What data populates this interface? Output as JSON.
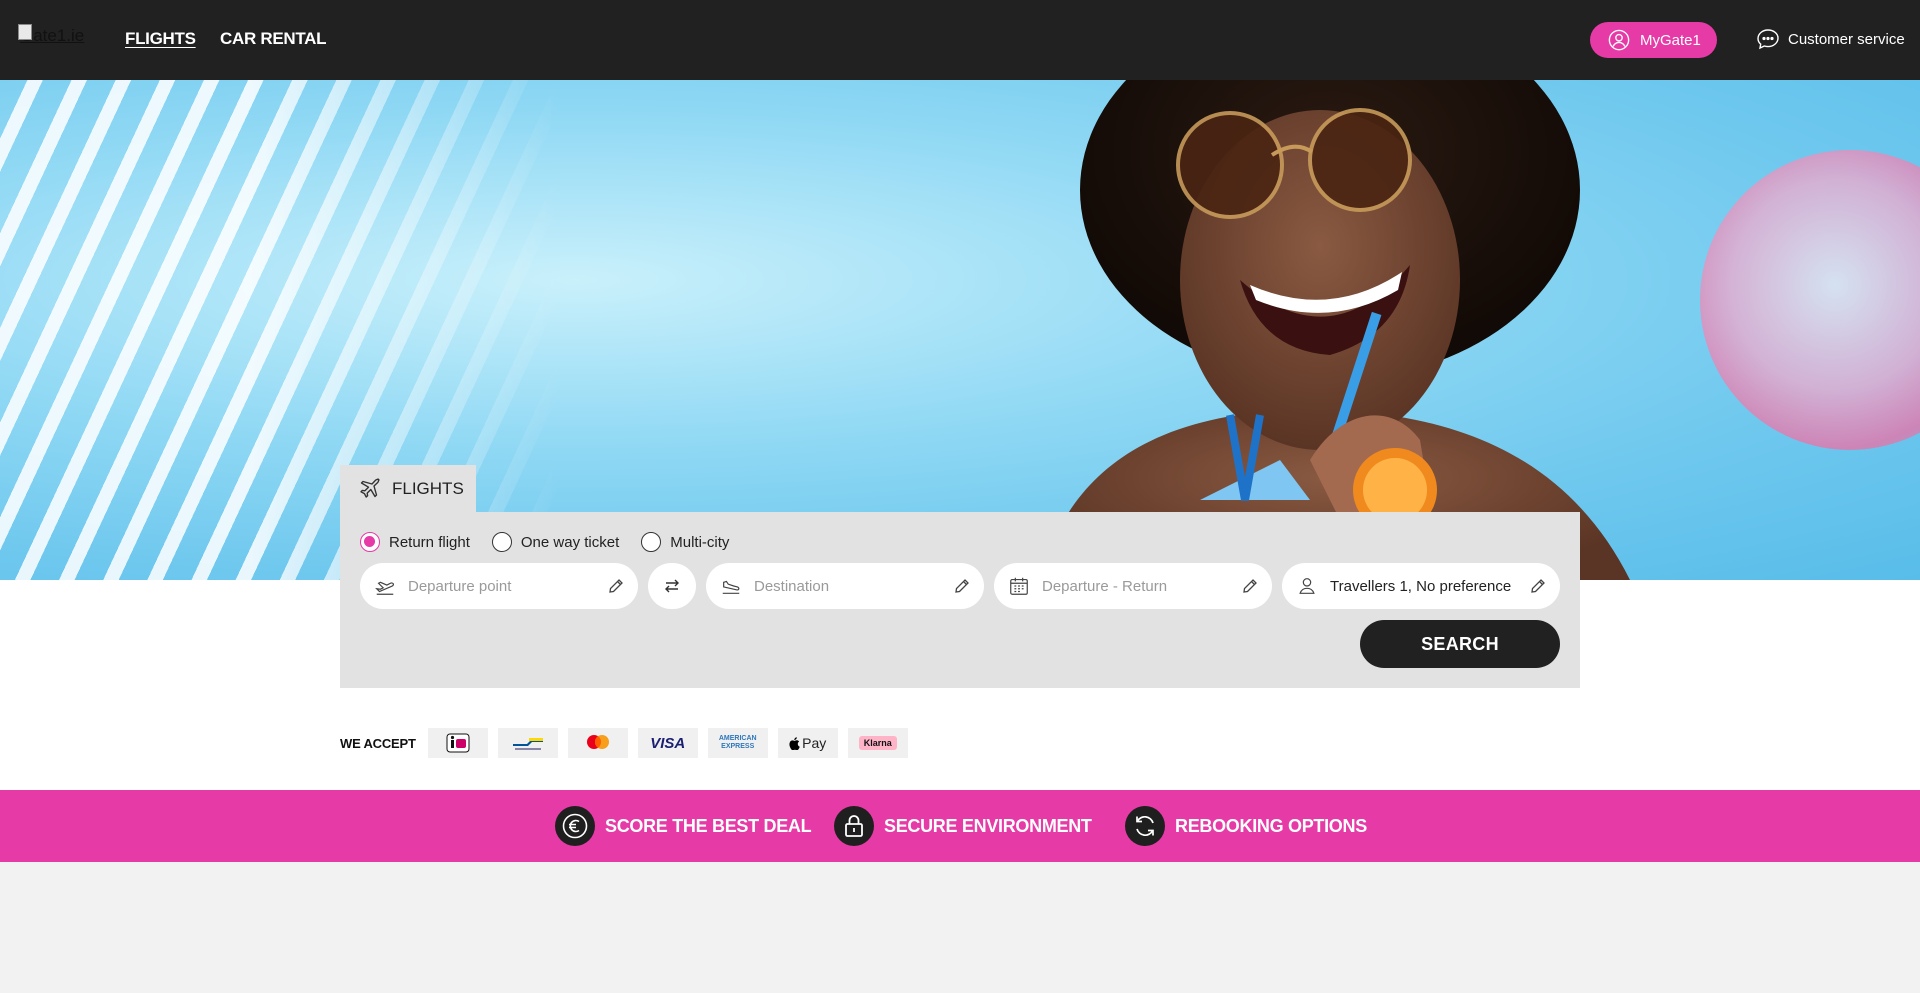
{
  "header": {
    "logo_alt": "Gate1.ie",
    "nav": [
      {
        "label": "FLIGHTS"
      },
      {
        "label": "CAR RENTAL"
      }
    ],
    "account_label": "MyGate1",
    "customer_service_label": "Customer service"
  },
  "search": {
    "tab_label": "FLIGHTS",
    "trip_types": [
      {
        "label": "Return flight",
        "selected": true
      },
      {
        "label": "One way ticket",
        "selected": false
      },
      {
        "label": "Multi-city",
        "selected": false
      }
    ],
    "departure_placeholder": "Departure point",
    "destination_placeholder": "Destination",
    "dates_placeholder": "Departure - Return",
    "travellers_value": "Travellers 1, No preference",
    "search_label": "SEARCH"
  },
  "payment": {
    "label": "WE ACCEPT",
    "methods": [
      {
        "name": "iDEAL",
        "icon": "ideal-icon"
      },
      {
        "name": "Bancontact",
        "icon": "bancontact-icon"
      },
      {
        "name": "Mastercard",
        "icon": "mastercard-icon"
      },
      {
        "name": "VISA",
        "icon": "visa-icon"
      },
      {
        "name": "AMERICAN EXPRESS",
        "icon": "amex-icon"
      },
      {
        "name": "Pay",
        "icon": "apple-pay-icon"
      },
      {
        "name": "Klarna",
        "icon": "klarna-icon"
      }
    ]
  },
  "usps": [
    {
      "label": "SCORE THE BEST DEAL",
      "icon": "euro-icon"
    },
    {
      "label": "SECURE ENVIRONMENT",
      "icon": "lock-icon"
    },
    {
      "label": "REBOOKING OPTIONS",
      "icon": "refresh-icon"
    }
  ],
  "colors": {
    "brand_pink": "#e63aa6",
    "header_dark": "#212121",
    "panel_grey": "#e2e2e2"
  }
}
